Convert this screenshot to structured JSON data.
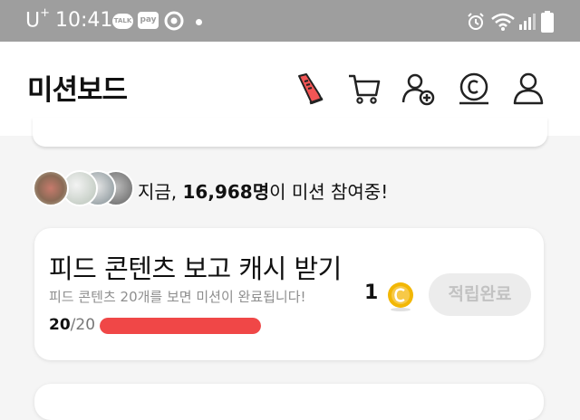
{
  "status_bar": {
    "carrier": "U",
    "carrier_sup": "+",
    "time": "10:41",
    "talk_badge": "TALK",
    "pay_badge": "pay"
  },
  "app_bar": {
    "title": "미션보드",
    "icons": [
      "sneaker-icon",
      "cart-icon",
      "add-friend-icon",
      "coin-icon",
      "profile-icon"
    ]
  },
  "participants": {
    "prefix": "지금, ",
    "count": "16,968명",
    "suffix": "이 미션 참여중!"
  },
  "mission": {
    "title": "피드 콘텐츠 보고 캐시 받기",
    "description": "피드 콘텐츠 20개를 보면 미션이 완료됩니다!",
    "reward": "1",
    "button_label": "적립완료",
    "progress_current": "20",
    "progress_total": "/20",
    "progress_fraction": 1.0
  },
  "colors": {
    "status_bar": "#9e9e9e",
    "progress": "#f04747",
    "coin": "#f2b705",
    "sneaker": "#f25555"
  }
}
